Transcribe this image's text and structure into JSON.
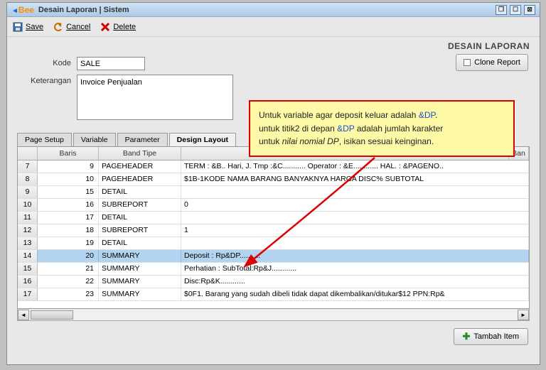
{
  "title": "Desain Laporan | Sistem",
  "logo": "Bee",
  "toolbar": {
    "save": "Save",
    "cancel": "Cancel",
    "delete": "Delete"
  },
  "headerLabel": "DESAIN LAPORAN",
  "labels": {
    "kode": "Kode",
    "keterangan": "Keterangan"
  },
  "kodeValue": "SALE",
  "keteranganValue": "Invoice Penjualan",
  "cloneBtn": "Clone Report",
  "tabs": {
    "pageSetup": "Page Setup",
    "variable": "Variable",
    "parameter": "Parameter",
    "designLayout": "Design Layout"
  },
  "columns": {
    "baris": "Baris",
    "bandTipe": "Band Tipe",
    "ban": "Ban"
  },
  "rows": [
    {
      "n": "7",
      "baris": "9",
      "tipe": "PAGEHEADER",
      "content": "TERM  : &B.. Hari, J. Tmp :&C...........        Operator : &E............   HAL. : &PAGENO.."
    },
    {
      "n": "8",
      "baris": "10",
      "tipe": "PAGEHEADER",
      "content": "$1B-1KODE        NAMA BARANG                   BANYAKNYA     HARGA    DISC%   SUBTOTAL"
    },
    {
      "n": "9",
      "baris": "15",
      "tipe": "DETAIL",
      "content": ""
    },
    {
      "n": "10",
      "baris": "16",
      "tipe": "SUBREPORT",
      "content": "0"
    },
    {
      "n": "11",
      "baris": "17",
      "tipe": "DETAIL",
      "content": ""
    },
    {
      "n": "12",
      "baris": "18",
      "tipe": "SUBREPORT",
      "content": "1"
    },
    {
      "n": "13",
      "baris": "19",
      "tipe": "DETAIL",
      "content": ""
    },
    {
      "n": "14",
      "baris": "20",
      "tipe": "SUMMARY",
      "content": "Deposit : Rp&DP..........",
      "selected": true
    },
    {
      "n": "15",
      "baris": "21",
      "tipe": "SUMMARY",
      "content": "Perhatian :                                           SubTotal:Rp&J............"
    },
    {
      "n": "16",
      "baris": "22",
      "tipe": "SUMMARY",
      "content": "                                                         Disc:Rp&K............"
    },
    {
      "n": "17",
      "baris": "23",
      "tipe": "SUMMARY",
      "content": "$0F1. Barang yang sudah dibeli tidak dapat dikembalikan/ditukar$12                  PPN:Rp&"
    }
  ],
  "addBtn": "Tambah Item",
  "callout": {
    "l1a": "Untuk variable agar deposit keluar adalah ",
    "l1b": "&DP",
    "l1c": ".",
    "l2a": "untuk titik2 di depan ",
    "l2b": "&DP",
    "l2c": " adalah jumlah karakter",
    "l3a": "untuk ",
    "l3b": "nilai nomial DP",
    "l3c": ", isikan sesuai keinginan."
  }
}
